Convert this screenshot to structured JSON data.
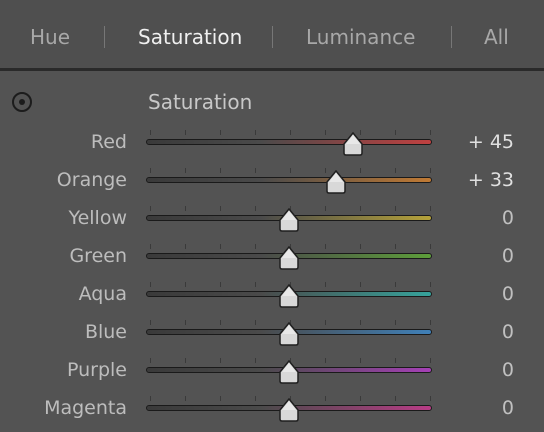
{
  "tabs": [
    {
      "label": "Hue",
      "active": false
    },
    {
      "label": "Saturation",
      "active": true
    },
    {
      "label": "Luminance",
      "active": false
    },
    {
      "label": "All",
      "active": false
    }
  ],
  "section": {
    "title": "Saturation",
    "tat_icon": "target-adjustment-icon"
  },
  "slider_range": [
    -100,
    100
  ],
  "sliders": [
    {
      "label": "Red",
      "value": 45,
      "display": "+ 45",
      "color": "#c04040"
    },
    {
      "label": "Orange",
      "value": 33,
      "display": "+ 33",
      "color": "#c07a34"
    },
    {
      "label": "Yellow",
      "value": 0,
      "display": "0",
      "color": "#b5a23a"
    },
    {
      "label": "Green",
      "value": 0,
      "display": "0",
      "color": "#5d9e3a"
    },
    {
      "label": "Aqua",
      "value": 0,
      "display": "0",
      "color": "#36a39c"
    },
    {
      "label": "Blue",
      "value": 0,
      "display": "0",
      "color": "#3f80b8"
    },
    {
      "label": "Purple",
      "value": 0,
      "display": "0",
      "color": "#a540b6"
    },
    {
      "label": "Magenta",
      "value": 0,
      "display": "0",
      "color": "#b83c86"
    }
  ]
}
